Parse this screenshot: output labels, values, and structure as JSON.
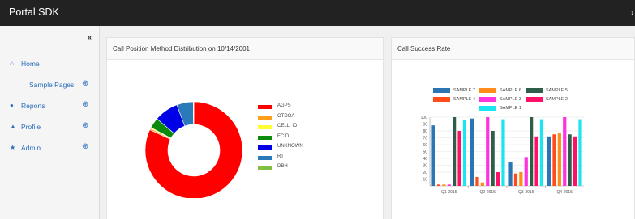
{
  "header": {
    "brand": "Portal SDK",
    "right_glyph": "↕"
  },
  "sidebar": {
    "collapse_glyph": "«",
    "items": [
      {
        "label": "Home",
        "icon": "home-icon",
        "glyph": "⌂",
        "expandable": false
      },
      {
        "label": "Sample Pages",
        "icon": "",
        "glyph": "",
        "expandable": true
      },
      {
        "label": "Reports",
        "icon": "reports-icon",
        "glyph": "●",
        "expandable": true
      },
      {
        "label": "Profile",
        "icon": "profile-icon",
        "glyph": "▲",
        "expandable": true
      },
      {
        "label": "Admin",
        "icon": "admin-icon",
        "glyph": "★",
        "expandable": true
      }
    ],
    "expand_glyph": "⊕"
  },
  "panels": {
    "left_title": "Call Position Method Distribution on 10/14/2001",
    "right_title": "Call Success Rate"
  },
  "chart_data": [
    {
      "type": "pie",
      "title": "Call Position Method Distribution on 10/14/2001",
      "donut": true,
      "categories": [
        "AGPS",
        "OTDOA",
        "CELL_ID",
        "ECID",
        "UNKNOWN",
        "RTT",
        "DBH"
      ],
      "values": [
        82,
        0.5,
        0.3,
        3.5,
        8,
        5.5,
        0.2
      ],
      "colors": [
        "#ff0000",
        "#ff9f1a",
        "#ffff33",
        "#0b8a0b",
        "#0000e6",
        "#2a7ab9",
        "#7fbf3f"
      ],
      "legend": "right"
    },
    {
      "type": "bar",
      "title": "Call Success Rate",
      "categories": [
        "Q1-2015",
        "Q2-2015",
        "Q3-2015",
        "Q4-2015"
      ],
      "ylim": [
        0,
        100
      ],
      "yticks": [
        10,
        20,
        30,
        40,
        50,
        60,
        70,
        80,
        90,
        100
      ],
      "legend": "top",
      "series": [
        {
          "name": "SAMPLE 7",
          "color": "#2a75b3",
          "values": [
            88,
            98,
            35,
            72
          ]
        },
        {
          "name": "SAMPLE 4",
          "color": "#ff4c1a",
          "values": [
            2,
            13,
            18,
            75
          ]
        },
        {
          "name": "SAMPLE 6",
          "color": "#ff8c1a",
          "values": [
            2,
            5,
            20,
            77
          ]
        },
        {
          "name": "SAMPLE 3",
          "color": "#ff33dd",
          "values": [
            2,
            100,
            42,
            100
          ]
        },
        {
          "name": "SAMPLE 5",
          "color": "#2e5d4a",
          "values": [
            100,
            80,
            100,
            75
          ]
        },
        {
          "name": "SAMPLE 2",
          "color": "#ff0f66",
          "values": [
            80,
            20,
            72,
            72
          ]
        },
        {
          "name": "SAMPLE 1",
          "color": "#1ae6f0",
          "values": [
            96,
            97,
            97,
            97
          ]
        }
      ]
    }
  ]
}
